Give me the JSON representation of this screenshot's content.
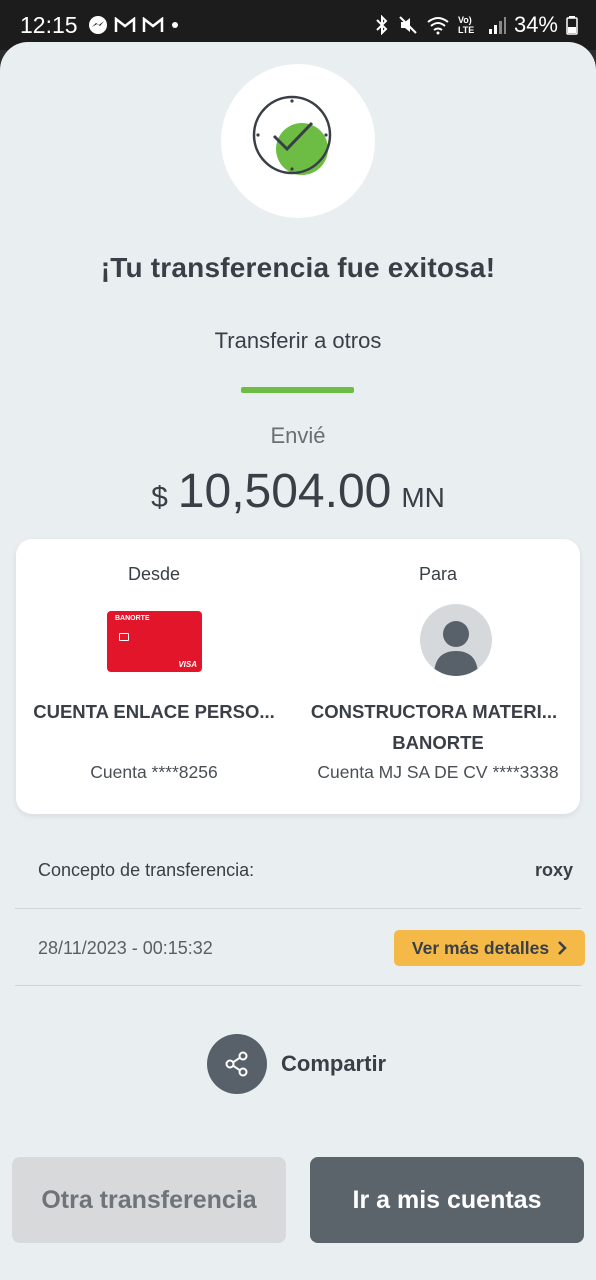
{
  "status_bar": {
    "time": "12:15",
    "notifications": [
      "messenger-icon",
      "gmail-icon",
      "gmail-icon",
      "dot"
    ],
    "battery": "34%",
    "network": "Vo) LTE"
  },
  "header": {
    "title": "¡Tu transferencia fue exitosa!",
    "subtitle": "Transferir a otros",
    "accent_color": "#6dbd45"
  },
  "amount": {
    "label": "Envié",
    "currency_symbol": "$",
    "value": "10,504.00",
    "currency_code": "MN"
  },
  "transfer": {
    "from": {
      "label": "Desde",
      "card_brand": "BANORTE",
      "card_network": "VISA",
      "name": "CUENTA ENLACE PERSO...",
      "account": "Cuenta ****8256"
    },
    "to": {
      "label": "Para",
      "name": "CONSTRUCTORA MATERI...",
      "bank": "BANORTE",
      "account": "Cuenta MJ SA DE CV ****3338"
    }
  },
  "details": {
    "concept_label": "Concepto de transferencia:",
    "concept_value": "roxy",
    "datetime": "28/11/2023 - 00:15:32",
    "more_details_label": "Ver más detalles"
  },
  "share": {
    "label": "Compartir"
  },
  "actions": {
    "secondary_label": "Otra transferencia",
    "primary_label": "Ir a mis cuentas"
  }
}
